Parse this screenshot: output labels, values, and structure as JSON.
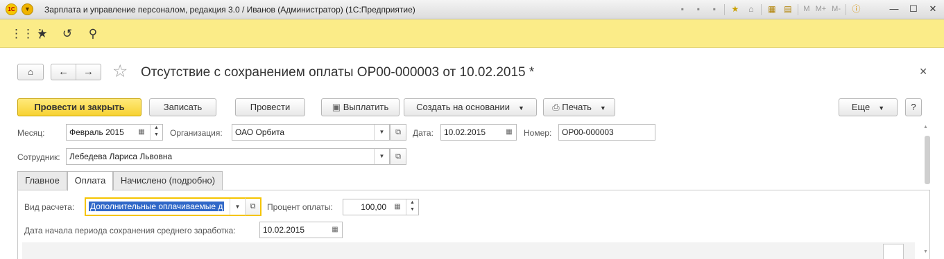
{
  "window": {
    "title": "Зарплата и управление персоналом, редакция 3.0 / Иванов (Администратор)  (1С:Предприятие)",
    "logo_text": "1С",
    "icon_m": "M",
    "icon_mplus": "M+",
    "icon_mminus": "M-"
  },
  "document": {
    "title": "Отсутствие с сохранением оплаты ОР00-000003 от 10.02.2015 *"
  },
  "commands": {
    "post_close": "Провести и закрыть",
    "save": "Записать",
    "post": "Провести",
    "pay": "Выплатить",
    "create_based": "Создать на основании",
    "print": "Печать",
    "more": "Еще",
    "help": "?"
  },
  "form": {
    "month_label": "Месяц:",
    "month_value": "Февраль 2015",
    "org_label": "Организация:",
    "org_value": "ОАО Орбита",
    "date_label": "Дата:",
    "date_value": "10.02.2015",
    "number_label": "Номер:",
    "number_value": "ОР00-000003",
    "employee_label": "Сотрудник:",
    "employee_value": "Лебедева Лариса Львовна"
  },
  "tabs": [
    {
      "label": "Главное"
    },
    {
      "label": "Оплата"
    },
    {
      "label": "Начислено (подробно)"
    }
  ],
  "payment": {
    "calc_type_label": "Вид расчета:",
    "calc_type_value": "Дополнительные оплачиваемые д",
    "percent_label": "Процент оплаты:",
    "percent_value": "100,00",
    "start_date_label": "Дата начала периода сохранения среднего заработка:",
    "start_date_value": "10.02.2015"
  }
}
